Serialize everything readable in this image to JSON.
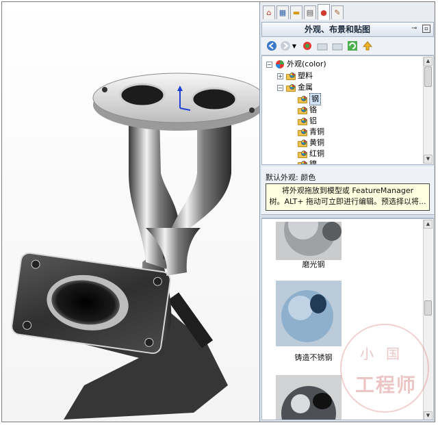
{
  "task_pane": {
    "tabs": [
      {
        "icon": "home-icon",
        "glyph": "⌂"
      },
      {
        "icon": "parts-icon",
        "glyph": "▦"
      },
      {
        "icon": "folder-icon",
        "glyph": "▬"
      },
      {
        "icon": "design-library-icon",
        "glyph": "▤"
      },
      {
        "icon": "appearances-icon",
        "glyph": "●"
      },
      {
        "icon": "custom-properties-icon",
        "glyph": "✎"
      }
    ],
    "title": "外观、布景和贴图",
    "toolbar": {
      "back": "back-icon",
      "forward": "forward-icon",
      "add": "add-appearance-icon",
      "folder1": "open-folder-icon",
      "folder2": "new-folder-icon",
      "refresh": "refresh-icon",
      "up": "up-level-icon"
    },
    "tree": {
      "root": "外观(color)",
      "items": [
        {
          "label": "塑料",
          "expanded": false
        },
        {
          "label": "金属",
          "expanded": true
        }
      ],
      "metal_children": [
        "钢",
        "铬",
        "铝",
        "青铜",
        "黄铜",
        "红铜",
        "镍"
      ],
      "selected": "钢"
    },
    "status": {
      "label": "默认外观: 颜色",
      "tooltip_line1": "将外观拖放到模型或 FeatureManager",
      "tooltip_line2": "树。ALT+ 拖动可立即进行编辑。预选择以将..."
    },
    "gallery": [
      {
        "label": "磨光钢"
      },
      {
        "label": "铸造不锈钢"
      },
      {
        "label": ""
      }
    ]
  },
  "watermark": {
    "top": "小国",
    "bottom": "工程师"
  },
  "colors": {
    "pane_bg": "#dfe6ef",
    "selection": "#cfe3fb",
    "tooltip_bg": "#ffffe1"
  }
}
